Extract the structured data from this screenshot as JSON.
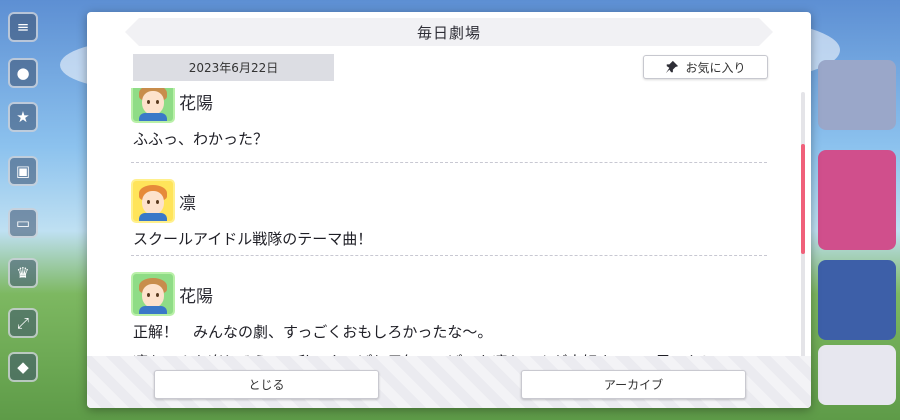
{
  "dialog": {
    "title": "毎日劇場",
    "date": "2023年6月22日",
    "favorite_label": "お気に入り",
    "close_label": "とじる",
    "archive_label": "アーカイブ"
  },
  "messages": [
    {
      "speaker": "花陽",
      "lines": [
        "ふふっ、わかった？"
      ],
      "avatar_color": "#8fdc86"
    },
    {
      "speaker": "凛",
      "lines": [
        "スクールアイドル戦隊のテーマ曲！"
      ],
      "avatar_color": "#ffe45a"
    },
    {
      "speaker": "花陽",
      "lines": [
        "正解！　みんなの劇、すっごくおもしろかったな〜。",
        "凛ちゃんも楽しそうで、私、やっぱり元気いっぱいな凛ちゃんが大好き、って思った！"
      ],
      "avatar_color": "#8fdc86"
    }
  ],
  "colors": {
    "scroll_thumb": "#f0607a",
    "accent": "#f0607a"
  },
  "icons": {
    "favorite": "pin-icon"
  }
}
